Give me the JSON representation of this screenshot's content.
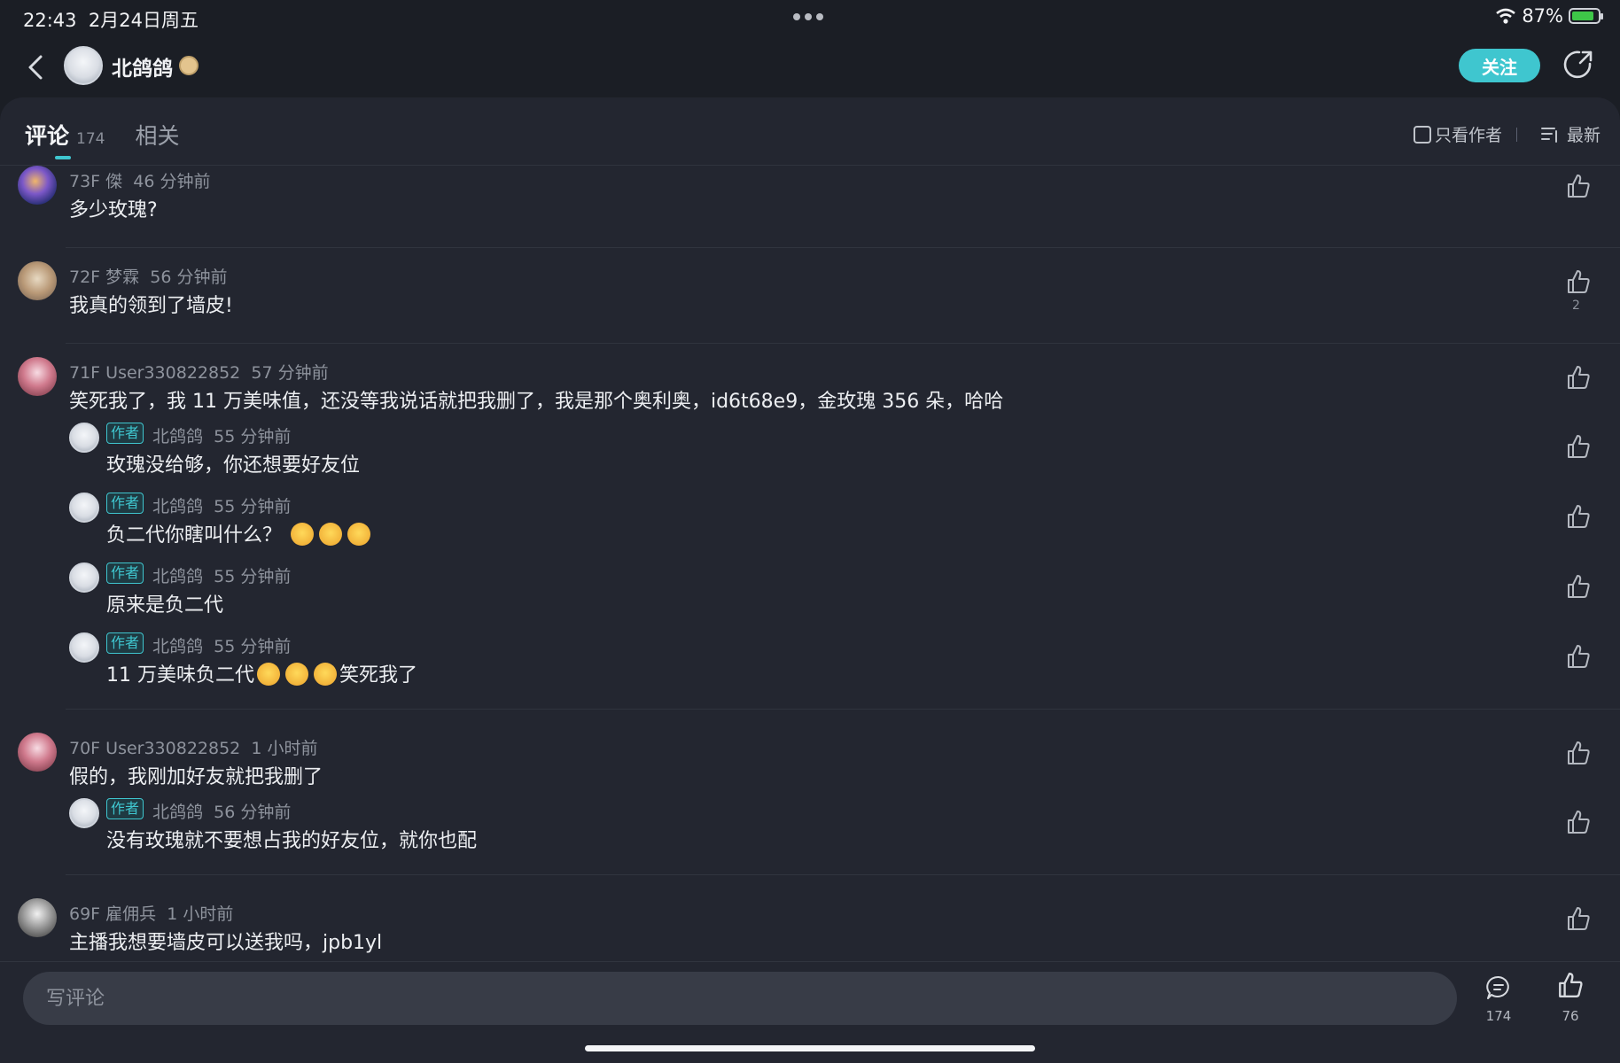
{
  "status": {
    "time": "22:43",
    "date": "2月24日周五",
    "battery": "87%",
    "battery_level": 0.87
  },
  "header": {
    "author_name": "北鸽鸽",
    "follow_label": "关注"
  },
  "tabs": {
    "comments_label": "评论",
    "comments_count": "174",
    "related_label": "相关"
  },
  "filters": {
    "author_only_label": "只看作者",
    "sort_label": "最新"
  },
  "comments": [
    {
      "floor": "73F",
      "user": "傑",
      "time": "46 分钟前",
      "text": "多少玫瑰?",
      "likes": ""
    },
    {
      "floor": "72F",
      "user": "梦霖",
      "time": "56 分钟前",
      "text": "我真的领到了墙皮!",
      "likes": "2"
    },
    {
      "floor": "71F",
      "user": "User330822852",
      "time": "57 分钟前",
      "text": "笑死我了，我 11 万美味值，还没等我说话就把我删了，我是那个奥利奥，id6t68e9，金玫瑰 356 朵，哈哈",
      "likes": "",
      "replies": [
        {
          "tag": "作者",
          "user": "北鸽鸽",
          "time": "55 分钟前",
          "text": "玫瑰没给够，你还想要好友位"
        },
        {
          "tag": "作者",
          "user": "北鸽鸽",
          "time": "55 分钟前",
          "text": "负二代你瞎叫什么？"
        },
        {
          "tag": "作者",
          "user": "北鸽鸽",
          "time": "55 分钟前",
          "text": "原来是负二代"
        },
        {
          "tag": "作者",
          "user": "北鸽鸽",
          "time": "55 分钟前",
          "text_before": "11 万美味负二代",
          "text_after": "笑死我了"
        }
      ]
    },
    {
      "floor": "70F",
      "user": "User330822852",
      "time": "1 小时前",
      "text": "假的，我刚加好友就把我删了",
      "likes": "",
      "replies": [
        {
          "tag": "作者",
          "user": "北鸽鸽",
          "time": "56 分钟前",
          "text": "没有玫瑰就不要想占我的好友位，就你也配"
        }
      ]
    },
    {
      "floor": "69F",
      "user": "雇佣兵",
      "time": "1 小时前",
      "text": "主播我想要墙皮可以送我吗，jpb1yl",
      "likes": ""
    }
  ],
  "bottom": {
    "input_placeholder": "写评论",
    "comment_count": "174",
    "like_count": "76"
  },
  "colors": {
    "accent": "#3fc6cf",
    "background": "#232630",
    "battery_green": "#3ec748"
  }
}
